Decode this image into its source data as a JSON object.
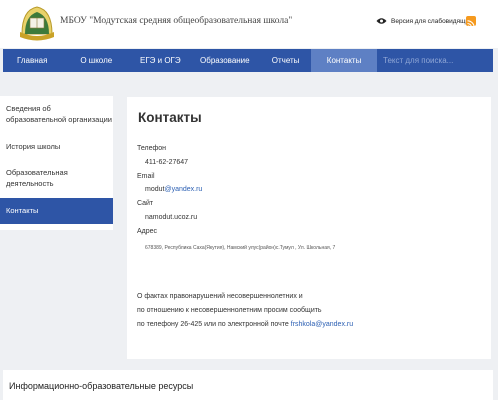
{
  "header": {
    "school_name": "МБОУ \"Модутская средняя общеобразовательная школа\"",
    "accessibility_link": "Версия для слабовидящих"
  },
  "nav": {
    "items": [
      {
        "label": "Главная"
      },
      {
        "label": "О школе"
      },
      {
        "label": "ЕГЭ и ОГЭ"
      },
      {
        "label": "Образование"
      },
      {
        "label": "Отчеты"
      },
      {
        "label": "Контакты"
      }
    ],
    "active": "Контакты",
    "search_placeholder": "Текст для поиска..."
  },
  "sidebar": {
    "items": [
      {
        "label": "Сведения об образовательной организации"
      },
      {
        "label": "История школы"
      },
      {
        "label": "Образовательная деятельность"
      },
      {
        "label": "Контакты"
      }
    ],
    "active": "Контакты"
  },
  "content": {
    "title": "Контакты",
    "phone_label": "Телефон",
    "phone": "411-62-27647",
    "email_label": "Email",
    "email_prefix": "modut",
    "email_domain": "@yandex.ru",
    "site_label": "Сайт",
    "site": "namodut.ucoz.ru",
    "address_label": "Адрес",
    "address": "678389, Республика Саха(Якутия), Намский улус(район)с.Тумул , Ул. Школьная, 7",
    "notice_line1": "О фактах правонарушений несовершеннолетних и",
    "notice_line2": "по отношению к несовершеннолетним просим сообщить",
    "notice_line3_prefix": "по телефону 26-425 или по электронной почте",
    "notice_email": "frshkola@yandex.ru"
  },
  "bottom": {
    "title": "Информационно-образовательные ресурсы"
  },
  "colors": {
    "nav_bg": "#2e55a6",
    "nav_active": "#5e80c4",
    "link": "#2b5fb3",
    "rss": "#f59a1f"
  }
}
